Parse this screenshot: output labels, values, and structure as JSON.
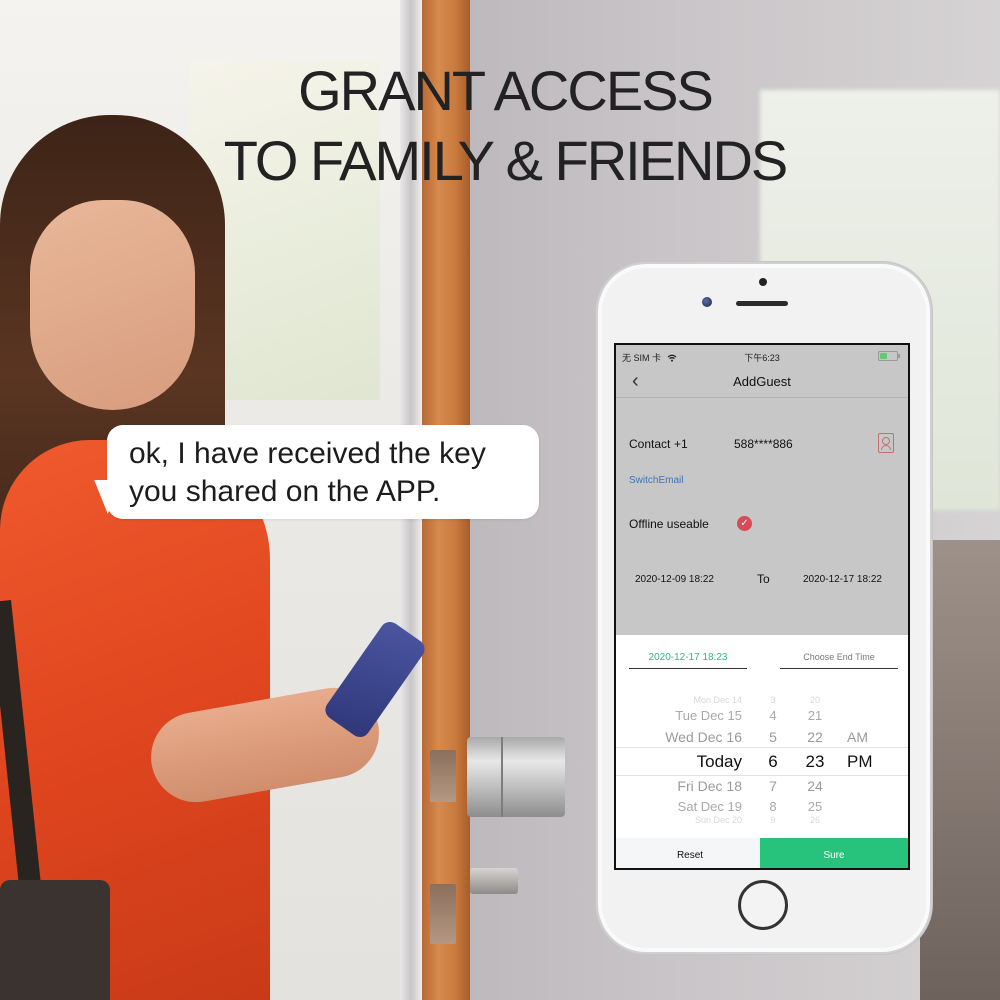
{
  "headline": {
    "line1": "GRANT ACCESS",
    "line2": "TO FAMILY & FRIENDS"
  },
  "speech_bubble": {
    "line1": "ok, I have received the key",
    "line2": "you shared on the APP."
  },
  "phone": {
    "status_bar": {
      "carrier": "无 SIM 卡",
      "wifi_icon": "wifi-icon",
      "time": "下午6:23",
      "battery_icon": "battery-icon"
    },
    "nav": {
      "back_icon": "‹",
      "title": "AddGuest"
    },
    "form": {
      "contact_label": "Contact",
      "country_code": "+1",
      "phone_number": "588****886",
      "contact_book_icon": "contact-book-icon",
      "switch_email": "SwitchEmail",
      "offline_label": "Offline useable",
      "offline_checked": true,
      "check_glyph": "✓",
      "start_date": "2020-12-09 18:22",
      "to_label": "To",
      "end_date": "2020-12-17 18:22"
    },
    "picker": {
      "tab_start": "2020-12-17 18:23",
      "tab_end_placeholder": "Choose End Time",
      "rows": [
        {
          "day": "Mon Dec 14",
          "hour": "3",
          "minute": "20",
          "ampm": ""
        },
        {
          "day": "Tue Dec 15",
          "hour": "4",
          "minute": "21",
          "ampm": ""
        },
        {
          "day": "Wed Dec 16",
          "hour": "5",
          "minute": "22",
          "ampm": "AM"
        },
        {
          "day": "Today",
          "hour": "6",
          "minute": "23",
          "ampm": "PM"
        },
        {
          "day": "Fri Dec 18",
          "hour": "7",
          "minute": "24",
          "ampm": ""
        },
        {
          "day": "Sat Dec 19",
          "hour": "8",
          "minute": "25",
          "ampm": ""
        },
        {
          "day": "Sun Dec 20",
          "hour": "9",
          "minute": "26",
          "ampm": ""
        }
      ],
      "selected_index": 3,
      "reset_label": "Reset",
      "sure_label": "Sure"
    },
    "colors": {
      "accent_green": "#27c27c",
      "check_red": "#d64b55",
      "link_blue": "#3d74b8",
      "contact_icon": "#c46e74"
    }
  }
}
